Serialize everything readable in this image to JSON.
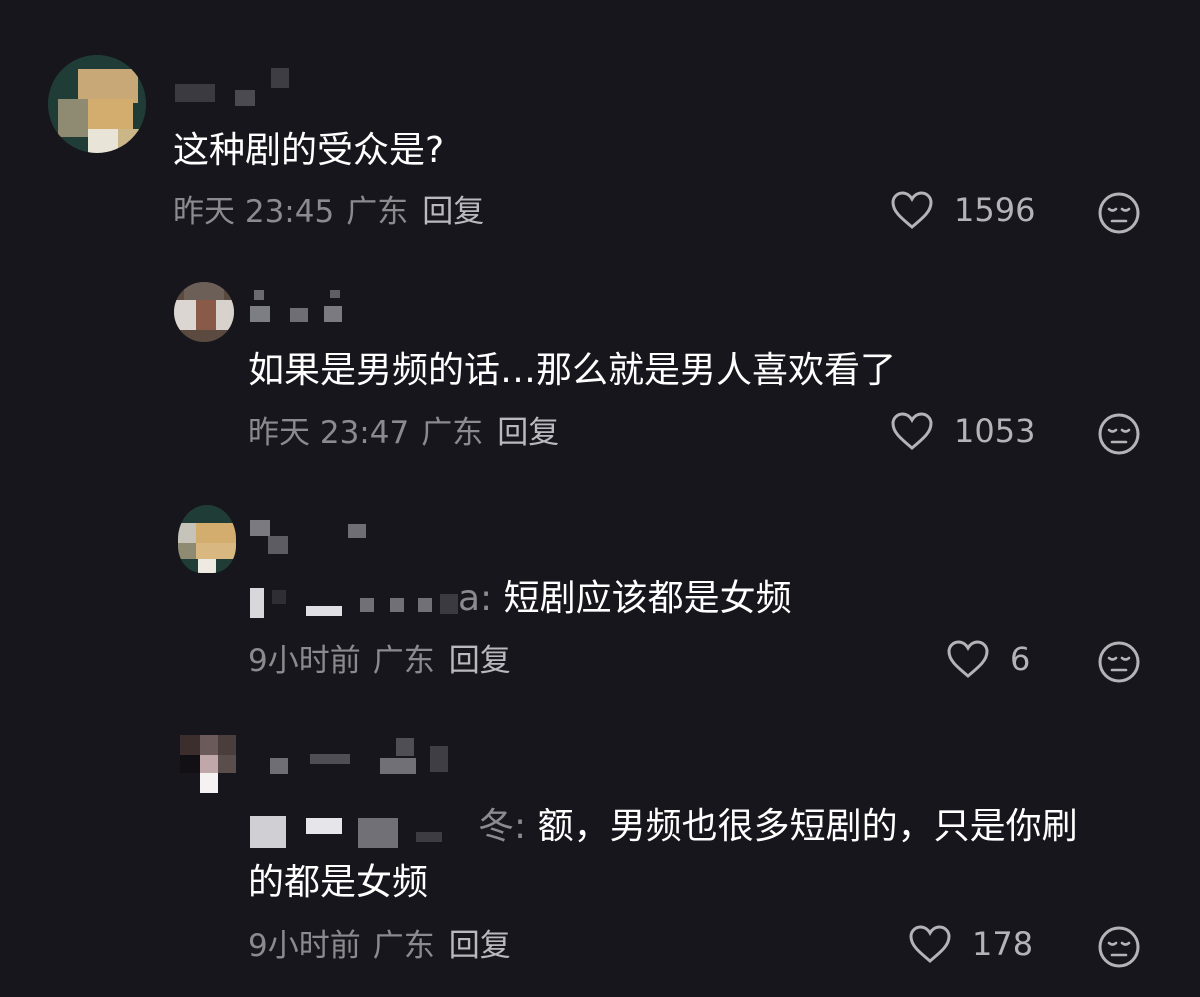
{
  "comments": [
    {
      "text": "这种剧的受众是?",
      "date": "昨天 23:45",
      "region": "广东",
      "reply_label": "回复",
      "likes": "1596"
    },
    {
      "text": "如果是男频的话…那么就是男人喜欢看了",
      "date": "昨天 23:47",
      "region": "广东",
      "reply_label": "回复",
      "likes": "1053"
    },
    {
      "reply_to_suffix": "a:",
      "text": "短剧应该都是女频",
      "date": "9小时前",
      "region": "广东",
      "reply_label": "回复",
      "likes": "6"
    },
    {
      "reply_to_suffix": "冬:",
      "text_line1": "额，男频也很多短剧的，只是你刷",
      "text_line2": "的都是女频",
      "date": "9小时前",
      "region": "广东",
      "reply_label": "回复",
      "likes": "178"
    }
  ],
  "colors": {
    "background": "#17161c",
    "primary_text": "#ffffff",
    "secondary_text": "#8a8a8f",
    "icon": "#b4b4b8"
  },
  "icons": [
    "heart-icon",
    "dislike-face-icon"
  ]
}
